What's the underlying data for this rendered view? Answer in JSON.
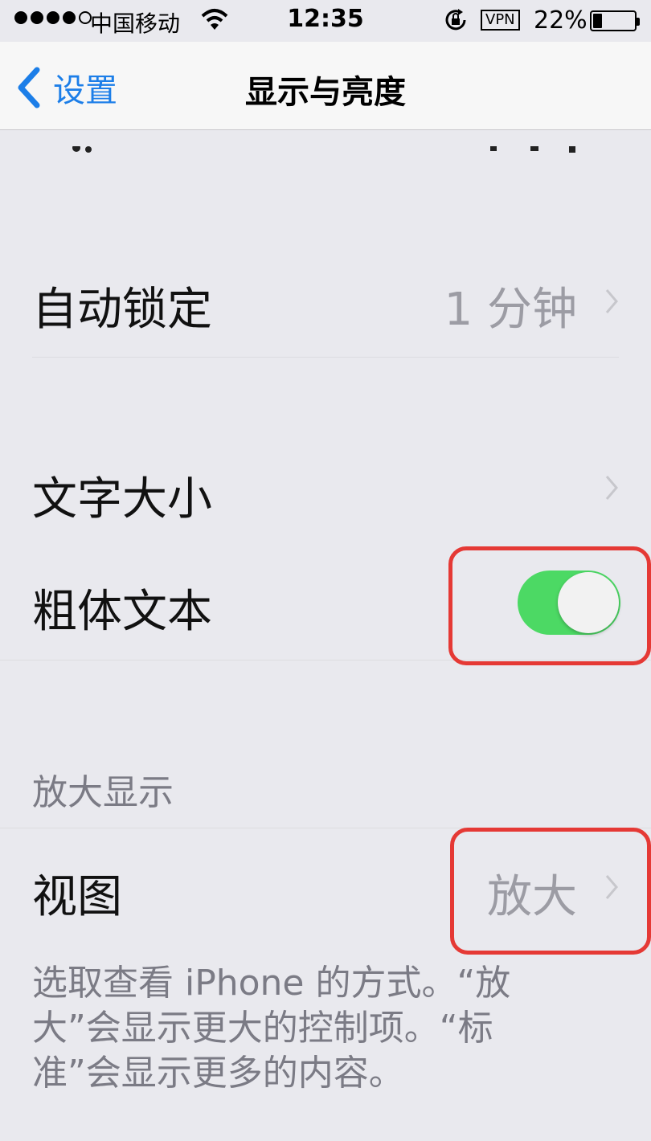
{
  "status_bar": {
    "carrier": "中国移动",
    "time": "12:35",
    "vpn_label": "VPN",
    "battery_percent_label": "22%",
    "battery_level": 0.22,
    "signal_bars_filled": 4,
    "signal_bars_total": 5
  },
  "nav": {
    "back_label": "设置",
    "title": "显示与亮度"
  },
  "rows": {
    "auto_lock": {
      "label": "自动锁定",
      "value": "1 分钟"
    },
    "text_size": {
      "label": "文字大小"
    },
    "bold_text": {
      "label": "粗体文本",
      "enabled": true
    },
    "view": {
      "label": "视图",
      "value": "放大"
    }
  },
  "zoom_section": {
    "header": "放大显示",
    "footer": "选取查看 iPhone 的方式。“放大”会显示更大的控制项。“标准”会显示更多的内容。"
  },
  "colors": {
    "accent_blue": "#1c7ee8",
    "toggle_on": "#4cd964",
    "highlight_red": "#e53935",
    "background": "#e9e9ee"
  }
}
